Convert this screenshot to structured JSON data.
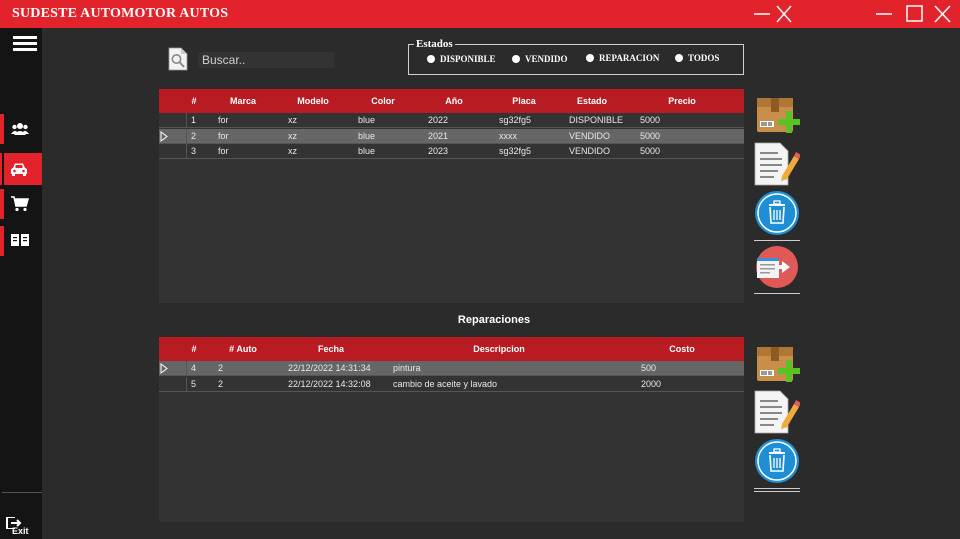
{
  "window": {
    "title": "SUDESTE  AUTOMOTOR  AUTOS"
  },
  "sidebar": {
    "items": [
      {
        "name": "clientes",
        "icon": "users-icon"
      },
      {
        "name": "autos",
        "icon": "car-icon"
      },
      {
        "name": "ventas",
        "icon": "cart-icon"
      },
      {
        "name": "reportes",
        "icon": "book-icon"
      }
    ],
    "exit_label": "Exit"
  },
  "search": {
    "placeholder": "Buscar.."
  },
  "estados": {
    "legend": "Estados",
    "options": [
      "DISPONIBLE",
      "VENDIDO",
      "REPARACION",
      "TODOS"
    ]
  },
  "autos_table": {
    "columns": [
      "#",
      "Marca",
      "Modelo",
      "Color",
      "Año",
      "Placa",
      "Estado",
      "Precio"
    ],
    "rows": [
      [
        "1",
        "for",
        "xz",
        "blue",
        "2022",
        "sg32fg5",
        "DISPONIBLE",
        "5000"
      ],
      [
        "2",
        "for",
        "xz",
        "blue",
        "2021",
        "xxxx",
        "VENDIDO",
        "5000"
      ],
      [
        "3",
        "for",
        "xz",
        "blue",
        "2023",
        "sg32fg5",
        "VENDIDO",
        "5000"
      ]
    ],
    "selected_row": 1
  },
  "reparaciones": {
    "title": "Reparaciones",
    "columns": [
      "#",
      "# Auto",
      "Fecha",
      "Descripcion",
      "Costo"
    ],
    "rows": [
      [
        "4",
        "2",
        "22/12/2022 14:31:34",
        "pintura",
        "500"
      ],
      [
        "5",
        "2",
        "22/12/2022 14:32:08",
        "cambio de aceite y lavado",
        "2000"
      ]
    ],
    "selected_row": 0
  },
  "colors": {
    "accent": "#e3232b",
    "header": "#b81c22",
    "background": "#2b2b2b",
    "sidebar": "#141414"
  }
}
